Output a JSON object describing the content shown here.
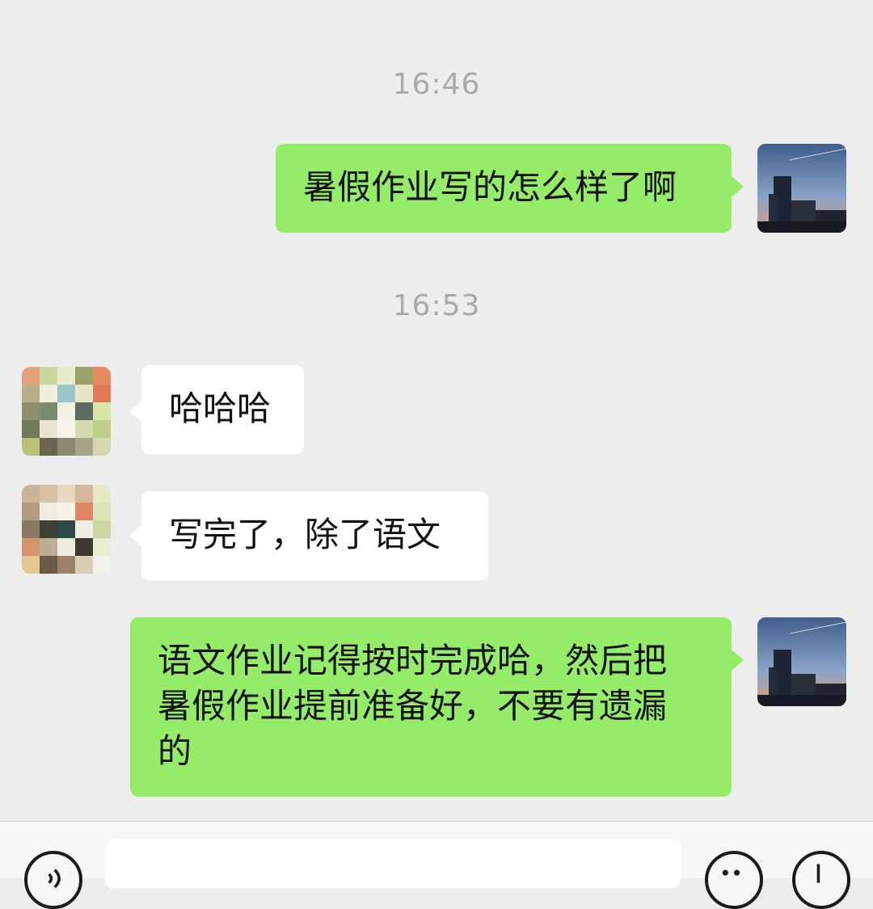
{
  "chat": {
    "messages": [
      {
        "type": "time",
        "text": "16:46"
      },
      {
        "type": "msg",
        "from": "me",
        "text": "暑假作业写的怎么样了啊"
      },
      {
        "type": "time",
        "text": "16:53"
      },
      {
        "type": "msg",
        "from": "other",
        "text": "哈哈哈"
      },
      {
        "type": "msg",
        "from": "other",
        "text": "写完了，除了语文"
      },
      {
        "type": "msg",
        "from": "me",
        "lines": [
          "语文作业记得按时完成哈，然后把",
          "暑假作业提前准备好，不要有遗漏",
          "的"
        ]
      }
    ]
  },
  "input_bar": {
    "voice_icon": "voice-icon",
    "emoji_icon": "emoji-icon",
    "plus_icon": "plus-icon"
  },
  "colors": {
    "background": "#ededed",
    "my_bubble": "#95ec69",
    "other_bubble": "#ffffff",
    "timestamp": "#a9a9a9"
  }
}
